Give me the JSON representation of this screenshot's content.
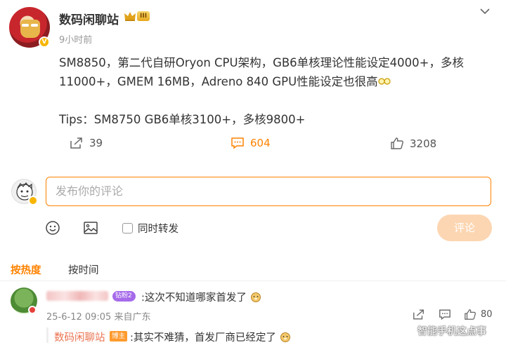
{
  "post": {
    "author": "数码闲聊站",
    "rank_badge": "III",
    "vip_badge": "V",
    "time": "9小时前",
    "lines": [
      "SM8850，第二代自研Oryon CPU架构，GB6单核理论性能设定4000+，多核",
      "11000+，GMEM 16MB，Adreno 840 GPU性能设定也很高",
      "Tips：SM8750 GB6单核3100+，多核9800+"
    ],
    "repost_count": "39",
    "comment_count": "604",
    "like_count": "3208"
  },
  "composer": {
    "placeholder": "发布你的评论",
    "repost_label": "同时转发",
    "submit_label": "评论"
  },
  "sort_tabs": {
    "hot": "按热度",
    "time": "按时间"
  },
  "comments": [
    {
      "level_chip": "钻粉2",
      "text": ":这次不知道哪家首发了",
      "meta": "25-6-12 09:05 来自广东",
      "like_count": "80",
      "reply": {
        "name": "数码闲聊站",
        "role": "博主",
        "text": ":其实不难猜，首发厂商已经定了"
      }
    }
  ],
  "watermark": "智能手机这点事",
  "colors": {
    "accent": "#ff8200",
    "reply_name": "#eb7350",
    "submit_disabled": "#fcd6b2"
  }
}
